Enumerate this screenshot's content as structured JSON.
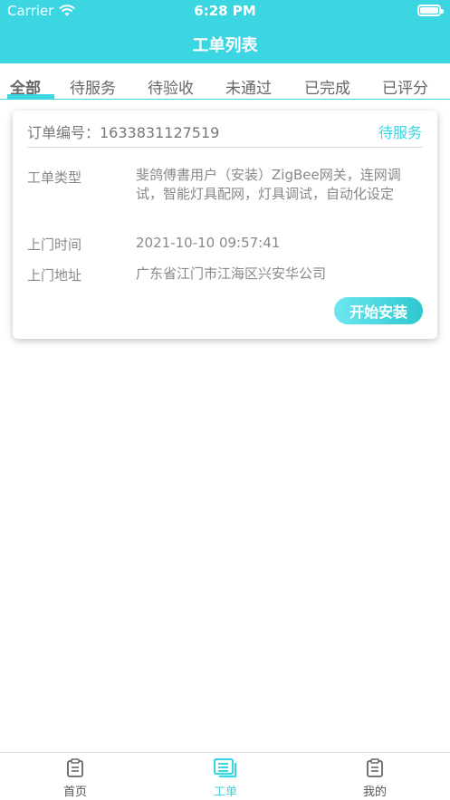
{
  "status_bar": {
    "carrier": "Carrier",
    "time": "6:28 PM"
  },
  "header": {
    "title": "工单列表"
  },
  "tabs": [
    {
      "label": "全部",
      "active": true
    },
    {
      "label": "待服务",
      "active": false
    },
    {
      "label": "待验收",
      "active": false
    },
    {
      "label": "未通过",
      "active": false
    },
    {
      "label": "已完成",
      "active": false
    },
    {
      "label": "已评分",
      "active": false
    }
  ],
  "order": {
    "number_text": "订单编号：1633831127519",
    "status": "待服务",
    "type_label": "工单类型",
    "type_value": "斐鸽傅書用户（安装）ZigBee网关，连网调试，智能灯具配网，灯具调试，自动化设定",
    "time_label": "上门时间",
    "time_value": "2021-10-10 09:57:41",
    "address_label": "上门地址",
    "address_value": "广东省江门市江海区兴安华公司",
    "action_label": "开始安装"
  },
  "bottom_nav": [
    {
      "label": "首页",
      "icon": "home-icon",
      "active": false
    },
    {
      "label": "工单",
      "icon": "orders-icon",
      "active": true
    },
    {
      "label": "我的",
      "icon": "profile-icon",
      "active": false
    }
  ],
  "colors": {
    "accent": "#3cd5e2",
    "text_gray": "#888888"
  }
}
